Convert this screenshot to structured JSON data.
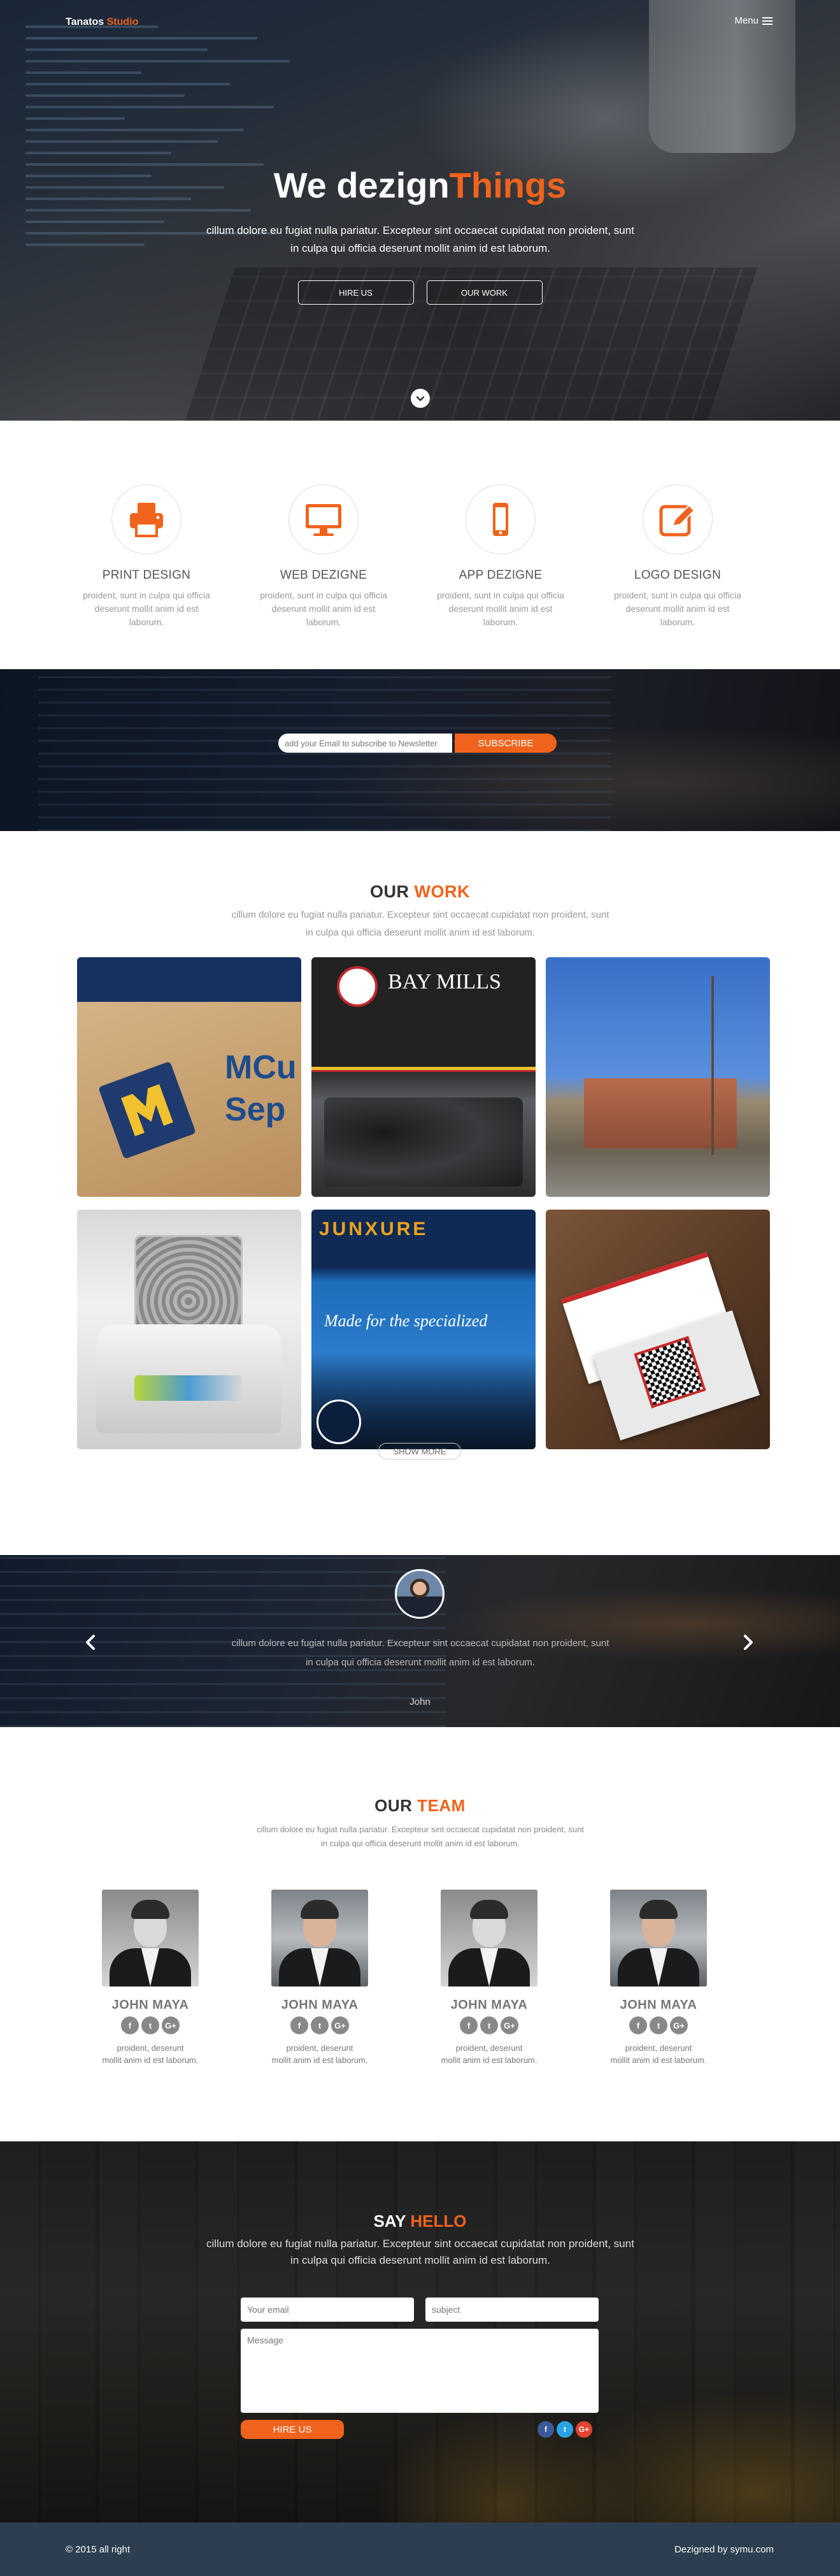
{
  "header": {
    "brand_main": "Tanatos",
    "brand_accent": "Studio",
    "menu_label": "Menu"
  },
  "hero": {
    "title_main": "We dezign",
    "title_accent": "Things",
    "text": "cillum dolore eu fugiat nulla pariatur. Excepteur sint occaecat cupidatat non proident, sunt in culpa qui officia deserunt mollit anim id est laborum.",
    "btn_hire": "HIRE US",
    "btn_work": "OUR WORK"
  },
  "services": [
    {
      "title": "PRINT DESIGN",
      "text": "proident, sunt in culpa qui officia deserunt mollit anim id est laborum.",
      "icon": "printer-icon"
    },
    {
      "title": "WEB DEZIGNE",
      "text": "proident, sunt in culpa qui officia deserunt mollit anim id est laborum.",
      "icon": "monitor-icon"
    },
    {
      "title": "APP DEZIGNE",
      "text": "proident, sunt in culpa qui officia deserunt mollit anim id est laborum.",
      "icon": "mobile-icon"
    },
    {
      "title": "LOGO DESIGN",
      "text": "proident, sunt in culpa qui officia deserunt mollit anim id est laborum.",
      "icon": "pencil-icon"
    }
  ],
  "newsletter": {
    "placeholder": "add your Email to subscribe to Newsletter",
    "button": "SUBSCRIBE"
  },
  "work": {
    "title_main": "OUR",
    "title_accent": "WORK",
    "text": "cillum dolore eu fugiat nulla pariatur. Excepteur sint occaecat cupidatat non proident, sunt in culpa qui officia deserunt mollit anim id est laborum.",
    "tiles": {
      "t1_text": "MCu Sep",
      "t2_name": "BAY MILLS",
      "t5_brand": "JUNXURE",
      "t5_tagline": "Made for the specialized"
    },
    "show_more": "SHOW MORE"
  },
  "testimonial": {
    "text": "cillum dolore eu fugiat nulla pariatur. Excepteur sint occaecat cupidatat non proident, sunt in culpa qui officia deserunt mollit anim id est laborum.",
    "name": "John"
  },
  "team": {
    "title_main": "OUR",
    "title_accent": "TEAM",
    "text": "cillum dolore eu fugiat nulla pariatur. Excepteur sint occaecat cupidatat non proident, sunt in culpa qui officia deserunt mollit anim id est laborum.",
    "members": [
      {
        "name": "JOHN MAYA",
        "text_1": "proident, deserunt",
        "text_2": "mollit anim id est laborum."
      },
      {
        "name": "JOHN MAYA",
        "text_1": "proident, deserunt",
        "text_2": "mollit anim id est laborum."
      },
      {
        "name": "JOHN MAYA",
        "text_1": "proident, deserunt",
        "text_2": "mollit anim id est laborum."
      },
      {
        "name": "JOHN MAYA",
        "text_1": "proident, deserunt",
        "text_2": "mollit anim id est laborum."
      }
    ],
    "social": {
      "facebook": "f",
      "twitter": "t",
      "google": "G+"
    }
  },
  "contact": {
    "title_main": "SAY",
    "title_accent": "HELLO",
    "text": "cillum dolore eu fugiat nulla pariatur. Excepteur sint occaecat cupidatat non proident, sunt in culpa qui officia deserunt mollit anim id est laborum.",
    "email_placeholder": "Your email",
    "subject_placeholder": "subject",
    "message_placeholder": "Message",
    "button": "HIRE US"
  },
  "footer": {
    "copyright": "© 2015 all right",
    "credit": "Dezigned by symu.com"
  },
  "colors": {
    "accent": "#f0631c",
    "footer": "#2c3e50",
    "facebook": "#3b5a9a",
    "twitter": "#2aa3e4",
    "google": "#e2442f"
  }
}
